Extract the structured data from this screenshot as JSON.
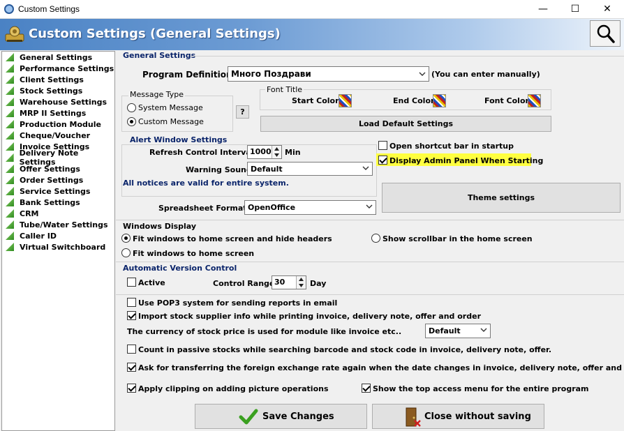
{
  "window": {
    "title": "Custom Settings",
    "minimize": "—",
    "maximize": "☐",
    "close": "✕"
  },
  "banner": {
    "title": "Custom Settings (General Settings)"
  },
  "sidebar": {
    "items": [
      {
        "label": "General Settings"
      },
      {
        "label": "Performance Settings"
      },
      {
        "label": "Client Settings"
      },
      {
        "label": "Stock Settings"
      },
      {
        "label": "Warehouse Settings"
      },
      {
        "label": "MRP II Settings"
      },
      {
        "label": "Production Module"
      },
      {
        "label": "Cheque/Voucher"
      },
      {
        "label": "Invoice Settings"
      },
      {
        "label": "Delivery Note Settings"
      },
      {
        "label": "Offer Settings"
      },
      {
        "label": "Order Settings"
      },
      {
        "label": "Service Settings"
      },
      {
        "label": "Bank Settings"
      },
      {
        "label": "CRM"
      },
      {
        "label": "Tube/Water Settings"
      },
      {
        "label": "Caller ID"
      },
      {
        "label": "Virtual Switchboard"
      }
    ]
  },
  "general": {
    "section": "General Settings",
    "program_definition_label": "Program Definition",
    "program_definition_value": "Много Поздрави",
    "program_definition_hint": "(You can enter manually)",
    "message_type": {
      "label": "Message Type",
      "system": "System Message",
      "custom": "Custom Message",
      "help": "?"
    },
    "font_title": {
      "label": "Font Title",
      "start": "Start Color",
      "end": "End Color",
      "font": "Font Color"
    },
    "load_default": "Load Default Settings",
    "alert": {
      "label": "Alert Window Settings",
      "refresh_label": "Refresh Control Interval",
      "refresh_value": "1000",
      "refresh_unit": "Min",
      "sound_label": "Warning Sound",
      "sound_value": "Default",
      "note": "All notices are valid for entire system."
    },
    "open_shortcut": "Open shortcut bar in startup",
    "display_admin": "Display Admin Panel When Starting",
    "theme": "Theme settings",
    "spreadsheet_label": "Spreadsheet Format",
    "spreadsheet_value": "OpenOffice"
  },
  "windows_display": {
    "section": "Windows Display",
    "fit_hide": "Fit windows to home screen and hide headers",
    "scrollbar": "Show scrollbar in the home screen",
    "fit": "Fit windows to home screen"
  },
  "version": {
    "section": "Automatic Version Control",
    "active": "Active",
    "range_label": "Control Range",
    "range_value": "30",
    "range_unit": "Day"
  },
  "options": {
    "pop3": "Use POP3 system for sending reports in email",
    "import_stock": "Import stock supplier info while printing invoice, delivery note, offer and order",
    "currency_label": "The currency of stock price is used for module like invoice etc..",
    "currency_value": "Default",
    "passive": "Count in passive stocks while searching barcode and stock code in invoice, delivery note, offer.",
    "exchange": "Ask for transferring the foreign exchange rate again when the date changes in invoice, delivery note, offer and order",
    "clipping": "Apply clipping on adding picture operations",
    "top_menu": "Show the top access menu for the entire program"
  },
  "footer": {
    "save": "Save Changes",
    "close": "Close without saving"
  }
}
